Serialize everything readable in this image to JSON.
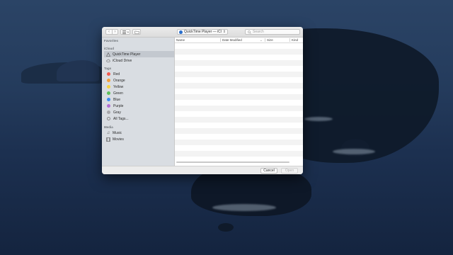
{
  "dialog": {
    "toolbar": {
      "location": "QuickTime Player — iCloud",
      "search_placeholder": "Search"
    },
    "sidebar": {
      "favorites_header": "Favorites",
      "icloud_header": "iCloud",
      "icloud_items": [
        {
          "label": "QuickTime Player",
          "icon": "quicktime-icon",
          "selected": true
        },
        {
          "label": "iCloud Drive",
          "icon": "cloud-icon",
          "selected": false
        }
      ],
      "tags_header": "Tags",
      "tags": [
        {
          "label": "Red",
          "color": "#f25b50"
        },
        {
          "label": "Orange",
          "color": "#f5a03a"
        },
        {
          "label": "Yellow",
          "color": "#f6d340"
        },
        {
          "label": "Green",
          "color": "#5cc15b"
        },
        {
          "label": "Blue",
          "color": "#3d8ef0"
        },
        {
          "label": "Purple",
          "color": "#b46fd6"
        },
        {
          "label": "Gray",
          "color": "#a7a7ab"
        }
      ],
      "all_tags": "All Tags...",
      "media_header": "Media",
      "media_items": [
        {
          "label": "Music",
          "icon": "music-icon"
        },
        {
          "label": "Movies",
          "icon": "film-icon"
        }
      ]
    },
    "columns": {
      "name": "Name",
      "date_modified": "Date Modified",
      "size": "Size",
      "kind": "Kind"
    },
    "footer": {
      "cancel": "Cancel",
      "open": "Open"
    }
  }
}
